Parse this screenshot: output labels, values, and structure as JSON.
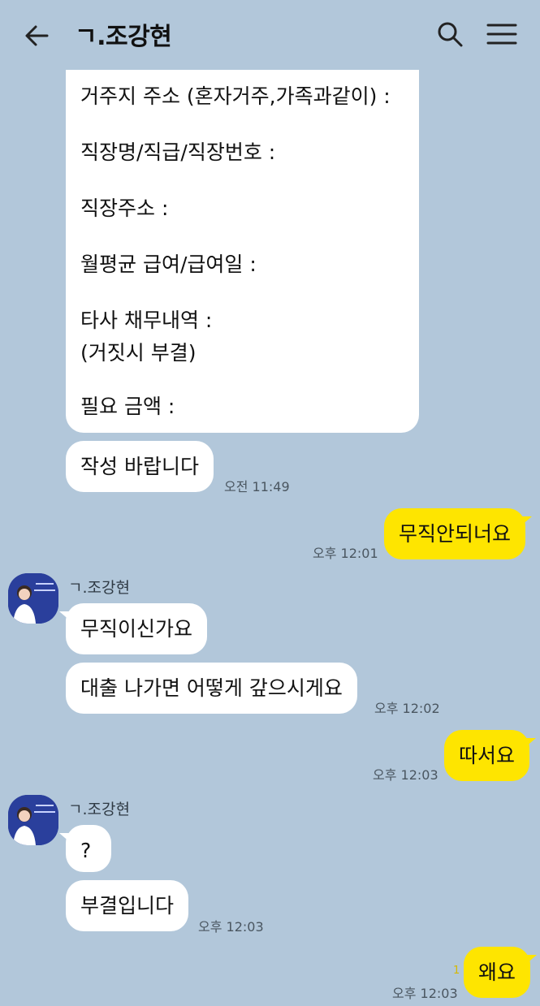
{
  "header": {
    "title": "ㄱ.조강현",
    "back_icon": "back-arrow-icon",
    "search_icon": "search-icon",
    "menu_icon": "menu-icon"
  },
  "form": {
    "lines": [
      "거주지 주소 (혼자거주,가족과같이) :",
      "직장명/직급/직장번호 :",
      "직장주소 :",
      "월평균 급여/급여일 :",
      "타사 채무내역 :",
      "(거짓시 부결)",
      "필요 금액 :"
    ]
  },
  "messages": [
    {
      "side": "in",
      "text": "작성 바랍니다",
      "time": "오전 11:49"
    },
    {
      "side": "out",
      "text": "무직안되너요",
      "time": "오후 12:01"
    },
    {
      "side": "in",
      "sender": "ㄱ.조강현",
      "text": "무직이신가요"
    },
    {
      "side": "in",
      "text": "대출 나가면 어떻게 갚으시게요",
      "time": "오후 12:02"
    },
    {
      "side": "out",
      "text": "따서요",
      "time": "오후 12:03"
    },
    {
      "side": "in",
      "sender": "ㄱ.조강현",
      "text": "?"
    },
    {
      "side": "in",
      "text": "부결입니다",
      "time": "오후 12:03"
    },
    {
      "side": "out",
      "text": "왜요",
      "time": "오후 12:03",
      "unread": "1"
    }
  ],
  "colors": {
    "background": "#b2c7da",
    "incoming_bubble": "#ffffff",
    "outgoing_bubble": "#fee500",
    "avatar_bg": "#2a3f9c"
  }
}
